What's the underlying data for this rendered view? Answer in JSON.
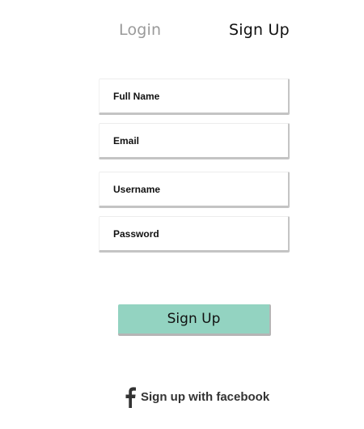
{
  "tabs": {
    "login_label": "Login",
    "signup_label": "Sign Up"
  },
  "form": {
    "full_name_placeholder": "Full Name",
    "email_placeholder": "Email",
    "username_placeholder": "Username",
    "password_placeholder": "Password",
    "submit_label": "Sign Up"
  },
  "social": {
    "facebook_label": "Sign up with facebook",
    "icon": "facebook-icon"
  },
  "colors": {
    "button_bg": "#93d3c1",
    "inactive_tab": "#9a9a9a",
    "field_shadow": "#c4c4c4"
  }
}
